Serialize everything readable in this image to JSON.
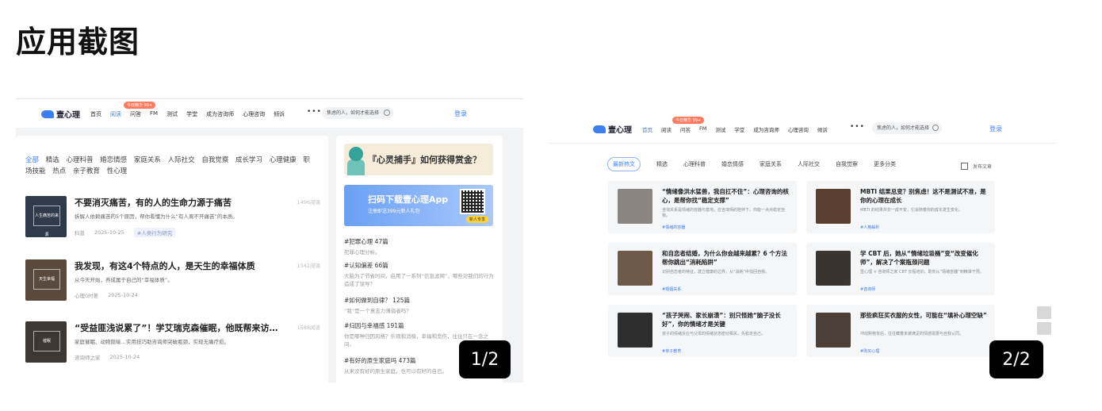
{
  "page": {
    "section_title": "应用截图"
  },
  "screenshot_1": {
    "counter": "1/2",
    "nav": {
      "brand": "壹心理",
      "badge": "今日精华 99+",
      "items": [
        "首页",
        "阅读",
        "问答",
        "FM",
        "测试",
        "学堂",
        "成为咨询师",
        "心理咨询",
        "倾诉"
      ],
      "more": "•••",
      "search_placeholder": "焦虑的人，如何才能选择",
      "login": "登录"
    },
    "categories": [
      "全部",
      "精选",
      "心理科普",
      "婚恋情感",
      "家庭关系",
      "人际社交",
      "自我觉察",
      "成长学习",
      "心理健康",
      "职场技能",
      "热点",
      "亲子教育",
      "性心理"
    ],
    "articles": [
      {
        "title": "不要消灭痛苦，有的人的生命力源于痛苦",
        "desc": "拆解人依赖痛苦的5个原因，帮你看懂为什么“有人离不开痛苦”的本质。",
        "author": "科普",
        "date": "2025-10-25",
        "tag": "#人类行为研究",
        "reads": "1496阅读",
        "thumb_text": "人生痛苦的来源"
      },
      {
        "title": "我发现，有这4个特点的人，是天生的幸福体质",
        "desc": "从今天开始，养成属于自己的“幸福体质”。",
        "author": "心理0时差",
        "date": "2025-10-24",
        "tag": "",
        "reads": "1542阅读",
        "thumb_text": "天生幸福"
      },
      {
        "title": "“受益匪浅说累了”！学艾瑞克森催眠，他既帮来访者…",
        "desc": "家庭催眠、动物隐喻…实用技巧助咨询师突破瓶颈，实现无痛疗愈。",
        "author": "咨询师之家",
        "date": "2025-10-24",
        "tag": "",
        "reads": "1588阅读",
        "thumb_text": "催眠"
      }
    ],
    "side": {
      "ad_title": "『心灵捕手』如何获得赏金？",
      "app_ad_title": "扫码下载壹心理App",
      "app_ad_sub": "注册即送399元新人礼包",
      "qr_button": "新人专享",
      "topics": [
        {
          "h": "#犯罪心理  47篇",
          "d": "犯罪心理分析。"
        },
        {
          "h": "#认知偏差  66篇",
          "d": "大脑为了节省时间，启用了一系列“信息滤网”，哪些对我们的行为造成了误导？"
        },
        {
          "h": "#如何做到自律？  125篇",
          "d": "“我”是一个意志力薄弱者吗？"
        },
        {
          "h": "#归因与幸福感  191篇",
          "d": "你是哪种归因风格？乐观和消极，幸福和悲伤，往往只在一念之间。"
        },
        {
          "h": "#有好的原生家庭吗  473篇",
          "d": "从来没有好的原生家庭，也可以有好的自己。"
        }
      ]
    }
  },
  "screenshot_2": {
    "counter": "2/2",
    "nav": {
      "brand": "壹心理",
      "badge": "今日精华 99+",
      "items": [
        "首页",
        "阅读",
        "问答",
        "FM",
        "测试",
        "学堂",
        "成为咨询师",
        "心理咨询",
        "倾诉"
      ],
      "more": "•••",
      "search_placeholder": "焦虑的人，如何才能选择",
      "login": "登录"
    },
    "tabs": [
      "最新热文",
      "精选",
      "心理科普",
      "婚恋情感",
      "家庭关系",
      "人际社交",
      "自我觉察",
      "更多分类"
    ],
    "publish": "发布文章",
    "cards": [
      {
        "t": "“情绪像洪水猛兽，我自扛不住”：心理咨询的核心，是帮你找“稳定支撑”",
        "d": "咨询关系是情绪的容器与基地，在咨询师的陪伴下，你能一点点稳定自我。",
        "tag": "#情绪的容器"
      },
      {
        "t": "MBTI 结果总变？别焦虑！这不是测试不准，是你的心理在成长",
        "d": "MBTI 的结果并非一成不变，它会随着你的成长发生变化。",
        "tag": "#人格解析"
      },
      {
        "t": "和自恋者结婚，为什么你会越来越累？6 个方法帮你跳出“消耗陷阱”",
        "d": "识别自恋者的特征，建立健康的边界，从“消耗”中找回自我。",
        "tag": "#婚姻关系"
      },
      {
        "t": "学 CBT 后，她从“情绪垃圾桶”变“改变催化师”，解决了个案瓶颈问题",
        "d": "壹心理 × 咨询师之家 CBT 长程培训，助你从“情绪容器”到精准干预。",
        "tag": "#咨询师"
      },
      {
        "t": "“孩子哭闹、家长崩溃”：别只怪她“脑子没长好”，你的情绪才是关键",
        "d": "孩子的情绪反应与父母的情绪状态密切相关，先稳定自己。",
        "tag": "#亲子教育"
      },
      {
        "t": "那些疯狂买衣服的女性，可能在“填补心理空缺”",
        "d": "冲动购物背后，往往藏着未被满足的情感需要与自我认同。",
        "tag": "#购买心理"
      }
    ]
  }
}
